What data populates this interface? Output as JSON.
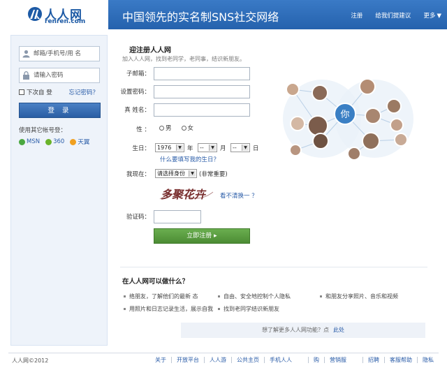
{
  "header": {
    "logo_text": "人人网",
    "logo_sub": "renren.com",
    "slogan": "中国领先的实名制SNS社交网络",
    "nav": {
      "register": "注册",
      "feedback": "给我们提建议",
      "more": "更多"
    },
    "brand_color": "#2f6eb8"
  },
  "sidebar": {
    "account_placeholder": "邮箱/手机号/用  名",
    "password_placeholder": "请输入密码",
    "remember_label": "下次自  登",
    "forgot_label": "忘记密码？",
    "login_label": "登  录",
    "other_accounts_title": "使用其它帐号登：",
    "other_accounts": [
      {
        "label": "MSN",
        "icon": "msn-icon",
        "color": "#4aa840"
      },
      {
        "label": "360",
        "icon": "360-icon",
        "color": "#6ab32a"
      },
      {
        "label": "天翼",
        "icon": "tianyi-icon",
        "color": "#f0a020"
      }
    ]
  },
  "register": {
    "title": "迎注册人人网",
    "subtitle": "加入人人网，找到老同学，老同事，结识新朋友。",
    "email_label": "子邮箱：",
    "password_label": "设置密码：",
    "name_label": "真    姓名：",
    "gender_label": "性  ：",
    "gender_male": "男",
    "gender_female": "女",
    "birthday_label": "生日：",
    "birth_year": "1976",
    "birth_month": "--",
    "birth_day": "--",
    "unit_year": "年",
    "unit_month": "月",
    "unit_day": "日",
    "why_birthday": "什么要填写我的生日？",
    "status_label": "我现在：",
    "status_select": "请选择身份",
    "status_note": "(非常重要)",
    "captcha_text": "多聚花卉",
    "captcha_refresh": "看不清换一  ？",
    "code_label": "验证码：",
    "submit_label": "立即注册"
  },
  "network": {
    "center_label": "你",
    "accent": "#3a7fc4"
  },
  "features": {
    "title": "在人人网可以做什么？",
    "items": [
      "络朋友，了解他们的最新   态",
      "自由、安全地控制个人隐私",
      "和朋友分享照片、音乐和视频",
      "用照片和日志记录生活，展示自我",
      "找到老同学结识新朋友"
    ],
    "learn_more": "想了解更多人人网功能？点",
    "learn_more_link": "此处"
  },
  "footer": {
    "copyright": "人人网©2012",
    "links": [
      "关于",
      "开放平台",
      "人人游",
      "公共主页",
      "手机人人",
      "购",
      "营销服",
      "招聘",
      "客服帮助",
      "隐私"
    ]
  }
}
